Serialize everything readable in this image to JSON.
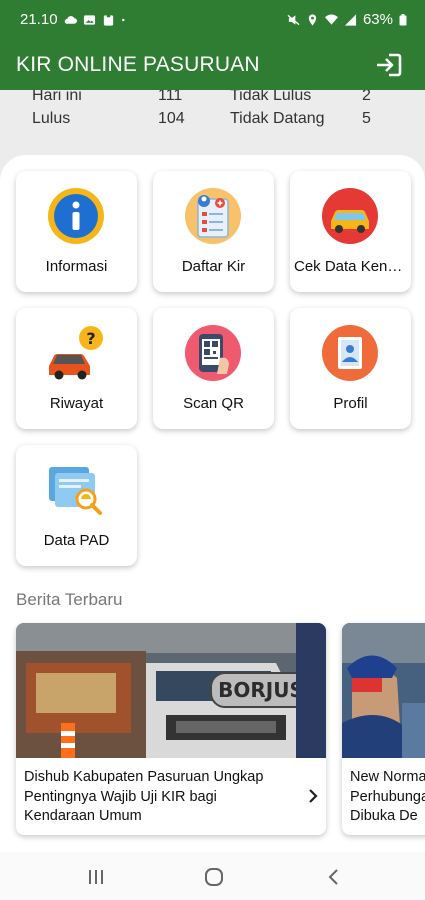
{
  "status": {
    "time": "21.10",
    "battery": "63%",
    "icons": [
      "cloud-icon",
      "image-icon",
      "clipboard-icon",
      "dot-icon",
      "mute-icon",
      "location-icon",
      "wifi-icon",
      "signal-icon",
      "battery-icon"
    ]
  },
  "app": {
    "title": "KIR ONLINE PASURUAN",
    "login_icon": "login-icon",
    "accent_color": "#2e7d32"
  },
  "summary": {
    "row1_label": "Hari ini",
    "row1_value": "111",
    "row1_label2": "Tidak Lulus",
    "row1_value2": "2",
    "row2_label": "Lulus",
    "row2_value": "104",
    "row2_label2": "Tidak Datang",
    "row2_value2": "5"
  },
  "menu": [
    {
      "label": "Informasi",
      "icon": "info-icon"
    },
    {
      "label": "Daftar Kir",
      "icon": "register-form-icon"
    },
    {
      "label": "Cek Data Kendaraan",
      "icon": "car-check-icon"
    },
    {
      "label": "Riwayat",
      "icon": "car-history-icon"
    },
    {
      "label": "Scan QR",
      "icon": "qr-scan-icon"
    },
    {
      "label": "Profil",
      "icon": "profile-icon"
    },
    {
      "label": "Data PAD",
      "icon": "data-search-icon"
    }
  ],
  "news": {
    "section_title": "Berita Terbaru",
    "items": [
      {
        "title": "Dishub Kabupaten Pasuruan Ungkap Pentingnya Wajib Uji KIR bagi Kendaraan Umum",
        "truck_text": "BORJUS"
      },
      {
        "title": "New Normal, Perhubungan Dibuka De"
      }
    ]
  },
  "navbar": {
    "icons": [
      "recent-apps-icon",
      "home-icon",
      "back-icon"
    ]
  }
}
